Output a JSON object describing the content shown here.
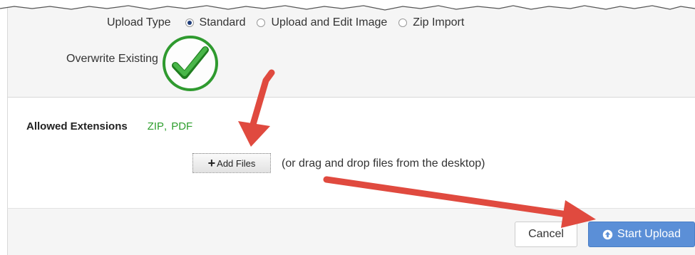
{
  "upload_type": {
    "label": "Upload Type",
    "options": [
      {
        "label": "Standard",
        "checked": true
      },
      {
        "label": "Upload and Edit Image",
        "checked": false
      },
      {
        "label": "Zip Import",
        "checked": false
      }
    ]
  },
  "overwrite": {
    "label": "Overwrite Existing",
    "checked": true,
    "icon": "checkmark-badge-icon"
  },
  "allowed": {
    "label": "Allowed Extensions",
    "extensions": [
      "ZIP",
      "PDF"
    ],
    "extension_color": "#2e9e2e"
  },
  "add_files": {
    "label": "Add Files",
    "icon": "plus-icon",
    "hint": "(or drag and drop files from the desktop)"
  },
  "footer": {
    "cancel_label": "Cancel",
    "start_label": "Start Upload",
    "start_icon": "upload-circle-icon",
    "accent": "#5b8fd7"
  },
  "annotations": {
    "arrow_color": "#e04a3f",
    "check_color": "#2f9a2f"
  }
}
